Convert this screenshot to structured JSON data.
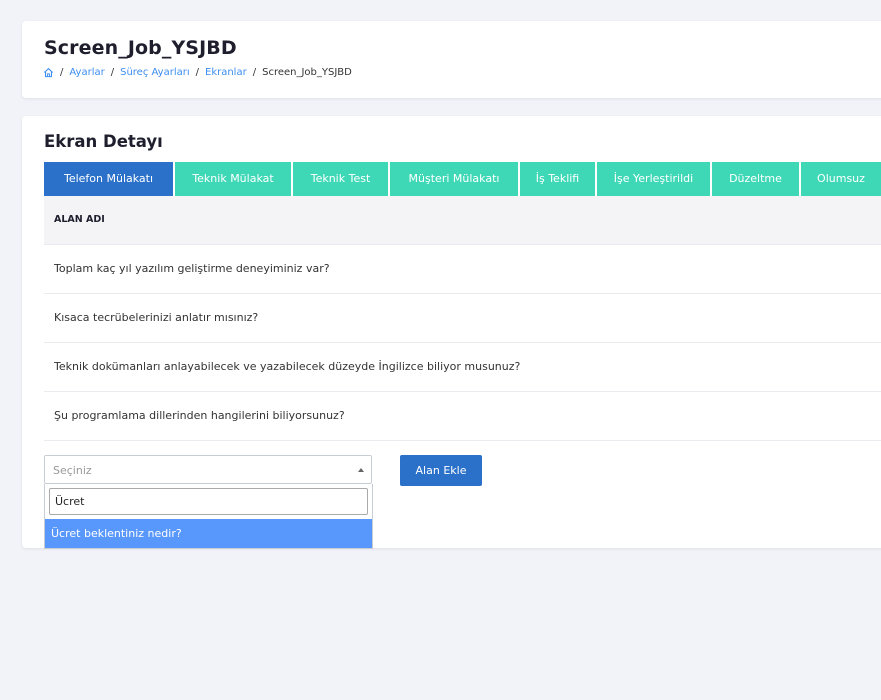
{
  "header": {
    "title": "Screen_Job_YSJBD",
    "breadcrumb": {
      "items": [
        "Ayarlar",
        "Süreç Ayarları",
        "Ekranlar"
      ],
      "current": "Screen_Job_YSJBD",
      "separator": "/"
    }
  },
  "main": {
    "title": "Ekran Detayı",
    "tabs": [
      {
        "label": "Telefon Mülakatı"
      },
      {
        "label": "Teknik Mülakat"
      },
      {
        "label": "Teknik Test"
      },
      {
        "label": "Müşteri Mülakatı"
      },
      {
        "label": "İş Teklifi"
      },
      {
        "label": "İşe Yerleştirildi"
      },
      {
        "label": "Düzeltme"
      },
      {
        "label": "Olumsuz"
      }
    ],
    "active_tab": "Telefon Mülakatı",
    "table": {
      "column_header": "ALAN ADI",
      "rows": [
        "Toplam kaç yıl yazılım geliştirme deneyiminiz var?",
        "Kısaca tecrübelerinizi anlatır mısınız?",
        "Teknik dokümanları anlayabilecek ve yazabilecek düzeyde İngilizce biliyor musunuz?",
        "Şu programlama dillerinden hangilerini biliyorsunuz?"
      ]
    },
    "field_select": {
      "placeholder": "Seçiniz",
      "search_value": "Ücret",
      "options": [
        "Ücret beklentiniz nedir?"
      ]
    },
    "add_button_label": "Alan Ekle"
  },
  "colors": {
    "primary": "#2b70c9",
    "tab": "#3ed8b6",
    "option_highlight": "#5897fb",
    "link": "#3d8ef0"
  },
  "icons": {
    "breadcrumb_home": "home-icon",
    "select_toggle": "caret-up-icon"
  }
}
